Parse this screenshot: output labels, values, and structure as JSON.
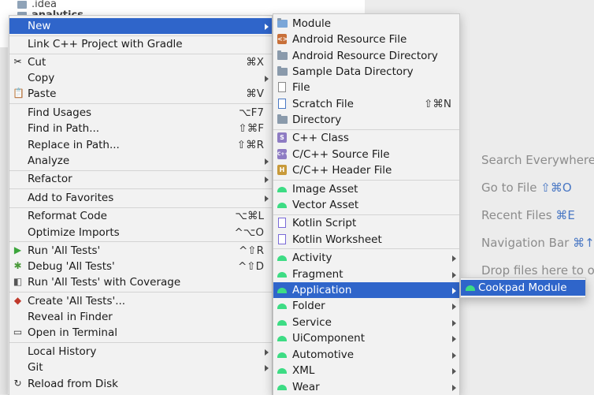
{
  "project_tree": {
    "row1": ".idea",
    "row2": "analytics"
  },
  "context_menu": {
    "new": "New",
    "link_cpp": "Link C++ Project with Gradle",
    "cut": "Cut",
    "cut_sc": "⌘X",
    "copy": "Copy",
    "paste": "Paste",
    "paste_sc": "⌘V",
    "find_usages": "Find Usages",
    "find_usages_sc": "⌥F7",
    "find_in_path": "Find in Path...",
    "find_in_path_sc": "⇧⌘F",
    "replace_in_path": "Replace in Path...",
    "replace_in_path_sc": "⇧⌘R",
    "analyze": "Analyze",
    "refactor": "Refactor",
    "add_favorites": "Add to Favorites",
    "reformat": "Reformat Code",
    "reformat_sc": "⌥⌘L",
    "optimize": "Optimize Imports",
    "optimize_sc": "^⌥O",
    "run_tests": "Run 'All Tests'",
    "run_tests_sc": "^⇧R",
    "debug_tests": "Debug 'All Tests'",
    "debug_tests_sc": "^⇧D",
    "run_coverage": "Run 'All Tests' with Coverage",
    "create_tests": "Create 'All Tests'...",
    "reveal": "Reveal in Finder",
    "open_terminal": "Open in Terminal",
    "local_history": "Local History",
    "git": "Git",
    "reload": "Reload from Disk"
  },
  "new_submenu": {
    "module": "Module",
    "android_resource_file": "Android Resource File",
    "android_resource_directory": "Android Resource Directory",
    "sample_data_directory": "Sample Data Directory",
    "file": "File",
    "scratch_file": "Scratch File",
    "scratch_file_sc": "⇧⌘N",
    "directory": "Directory",
    "cpp_class": "C++ Class",
    "cpp_source": "C/C++ Source File",
    "cpp_header": "C/C++ Header File",
    "image_asset": "Image Asset",
    "vector_asset": "Vector Asset",
    "kotlin_script": "Kotlin Script",
    "kotlin_worksheet": "Kotlin Worksheet",
    "activity": "Activity",
    "fragment": "Fragment",
    "application": "Application",
    "folder": "Folder",
    "service": "Service",
    "uicomponent": "UiComponent",
    "automotive": "Automotive",
    "xml": "XML",
    "wear": "Wear"
  },
  "application_submenu": {
    "cookpad_module": "Cookpad Module"
  },
  "editor_hints": {
    "search": "Search Everywhere",
    "goto_file": "Go to File",
    "goto_file_sc": "⇧⌘O",
    "recent": "Recent Files",
    "recent_sc": "⌘E",
    "navbar": "Navigation Bar",
    "navbar_sc": "⌘↑",
    "drop": "Drop files here to o"
  },
  "colors": {
    "selection": "#2f65ca",
    "android_green": "#3ddc84"
  }
}
